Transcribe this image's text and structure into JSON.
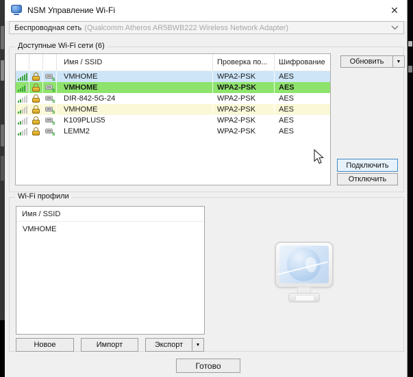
{
  "window": {
    "title": "NSM Управление Wi-Fi"
  },
  "icons": {
    "close": "✕",
    "dropdown_arrow": "▼",
    "device_badge": "s"
  },
  "adapter_bar": {
    "label": "Беспроводная сеть",
    "adapter": "(Qualcomm Atheros AR5BWB222 Wireless Network Adapter)"
  },
  "networks": {
    "group_title": "Доступные Wi-Fi сети (6)",
    "columns": {
      "name": "Имя / SSID",
      "auth": "Проверка по...",
      "encryption": "Шифрование"
    },
    "rows": [
      {
        "ssid": "VMHOME",
        "auth": "WPA2-PSK",
        "encryption": "AES",
        "signal_bars": 5,
        "secured": true,
        "highlight": "selected",
        "bold": false
      },
      {
        "ssid": "VMHOME",
        "auth": "WPA2-PSK",
        "encryption": "AES",
        "signal_bars": 4,
        "secured": true,
        "highlight": "connected",
        "bold": true
      },
      {
        "ssid": "DIR-842-5G-24",
        "auth": "WPA2-PSK",
        "encryption": "AES",
        "signal_bars": 2,
        "secured": true,
        "highlight": "none",
        "bold": false
      },
      {
        "ssid": "VMHOME",
        "auth": "WPA2-PSK",
        "encryption": "AES",
        "signal_bars": 2,
        "secured": true,
        "highlight": "profile",
        "bold": false
      },
      {
        "ssid": "K109PLUS5",
        "auth": "WPA2-PSK",
        "encryption": "AES",
        "signal_bars": 2,
        "secured": true,
        "highlight": "none",
        "bold": false
      },
      {
        "ssid": "LEMM2",
        "auth": "WPA2-PSK",
        "encryption": "AES",
        "signal_bars": 2,
        "secured": true,
        "highlight": "none",
        "bold": false
      }
    ],
    "refresh_button": "Обновить",
    "connect_button": "Подключить",
    "disconnect_button": "Отключить"
  },
  "profiles": {
    "group_title": "Wi-Fi профили",
    "list_header": "Имя / SSID",
    "items": [
      "VMHOME"
    ],
    "new_button": "Новое",
    "import_button": "Импорт",
    "export_button": "Экспорт"
  },
  "footer": {
    "done_button": "Готово"
  },
  "colors": {
    "row_selected": "#cde5f7",
    "row_connected": "#8ee36c",
    "row_profile": "#fbf8d7",
    "accent_border": "#4288c6",
    "default_button_bg": "#e6f2fb",
    "signal_active": "#3aa33a"
  }
}
